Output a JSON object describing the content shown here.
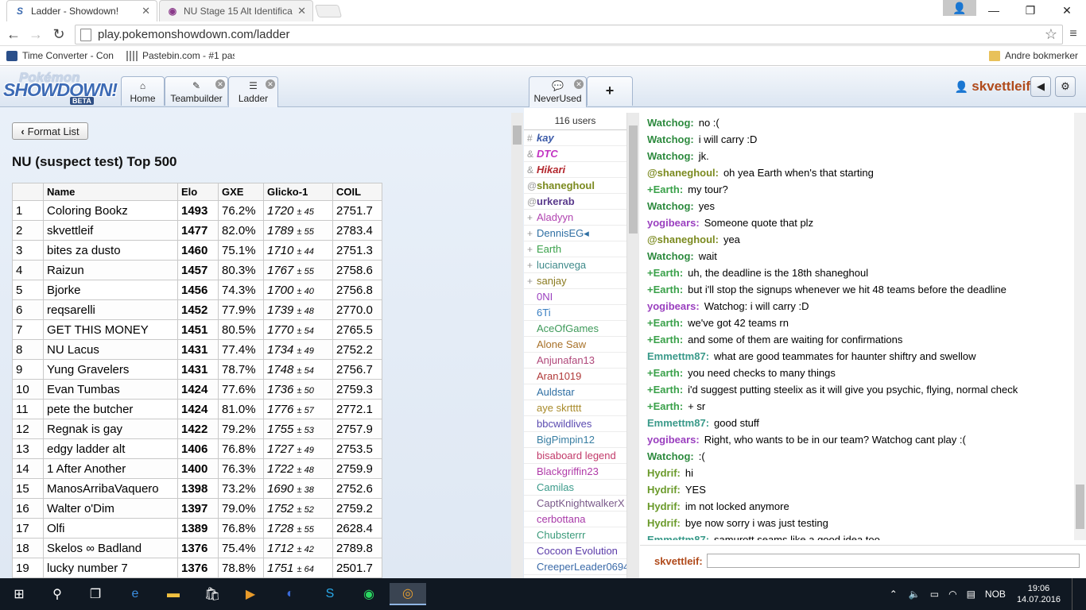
{
  "browser": {
    "tabs": [
      {
        "title": "Ladder - Showdown!",
        "icon": "showdown-favicon"
      },
      {
        "title": "NU Stage 15 Alt Identifica",
        "icon": "forum-favicon"
      }
    ],
    "url": "play.pokemonshowdown.com/ladder",
    "bookmarks": [
      {
        "label": "Time Converter - Con"
      },
      {
        "label": "Pastebin.com - #1 pas"
      }
    ],
    "bookmark_folder": "Andre bokmerker"
  },
  "header": {
    "logo_top": "Pokémon",
    "logo_main": "SHOWDOWN!",
    "logo_badge": "BETA",
    "tabs": [
      {
        "label": "Home",
        "icon": "home-icon"
      },
      {
        "label": "Teambuilder",
        "icon": "pencil-icon"
      },
      {
        "label": "Ladder",
        "icon": "list-icon"
      }
    ],
    "room_tab": "NeverUsed",
    "add_room": "+",
    "username": "skvettleif"
  },
  "ladder": {
    "back_label": "Format List",
    "title": "NU (suspect test) Top 500",
    "columns": [
      "",
      "Name",
      "Elo",
      "GXE",
      "Glicko-1",
      "COIL"
    ],
    "rows": [
      {
        "rank": "1",
        "name": "Coloring Bookz",
        "elo": "1493",
        "gxe": "76.2%",
        "glicko": "1720",
        "dev": "± 45",
        "coil": "2751.7"
      },
      {
        "rank": "2",
        "name": "skvettleif",
        "elo": "1477",
        "gxe": "82.0%",
        "glicko": "1789",
        "dev": "± 55",
        "coil": "2783.4"
      },
      {
        "rank": "3",
        "name": "bites za dusto",
        "elo": "1460",
        "gxe": "75.1%",
        "glicko": "1710",
        "dev": "± 44",
        "coil": "2751.3"
      },
      {
        "rank": "4",
        "name": "Raizun",
        "elo": "1457",
        "gxe": "80.3%",
        "glicko": "1767",
        "dev": "± 55",
        "coil": "2758.6"
      },
      {
        "rank": "5",
        "name": "Bjorke",
        "elo": "1456",
        "gxe": "74.3%",
        "glicko": "1700",
        "dev": "± 40",
        "coil": "2756.8"
      },
      {
        "rank": "6",
        "name": "reqsarelli",
        "elo": "1452",
        "gxe": "77.9%",
        "glicko": "1739",
        "dev": "± 48",
        "coil": "2770.0"
      },
      {
        "rank": "7",
        "name": "GET THIS MONEY",
        "elo": "1451",
        "gxe": "80.5%",
        "glicko": "1770",
        "dev": "± 54",
        "coil": "2765.5"
      },
      {
        "rank": "8",
        "name": "NU Lacus",
        "elo": "1431",
        "gxe": "77.4%",
        "glicko": "1734",
        "dev": "± 49",
        "coil": "2752.2"
      },
      {
        "rank": "9",
        "name": "Yung Gravelers",
        "elo": "1431",
        "gxe": "78.7%",
        "glicko": "1748",
        "dev": "± 54",
        "coil": "2756.7"
      },
      {
        "rank": "10",
        "name": "Evan Tumbas",
        "elo": "1424",
        "gxe": "77.6%",
        "glicko": "1736",
        "dev": "± 50",
        "coil": "2759.3"
      },
      {
        "rank": "11",
        "name": "pete the butcher",
        "elo": "1424",
        "gxe": "81.0%",
        "glicko": "1776",
        "dev": "± 57",
        "coil": "2772.1"
      },
      {
        "rank": "12",
        "name": "Regnak is gay",
        "elo": "1422",
        "gxe": "79.2%",
        "glicko": "1755",
        "dev": "± 53",
        "coil": "2757.9"
      },
      {
        "rank": "13",
        "name": "edgy ladder alt",
        "elo": "1406",
        "gxe": "76.8%",
        "glicko": "1727",
        "dev": "± 49",
        "coil": "2753.5"
      },
      {
        "rank": "14",
        "name": "1 After Another",
        "elo": "1400",
        "gxe": "76.3%",
        "glicko": "1722",
        "dev": "± 48",
        "coil": "2759.9"
      },
      {
        "rank": "15",
        "name": "ManosArribaVaquero",
        "elo": "1398",
        "gxe": "73.2%",
        "glicko": "1690",
        "dev": "± 38",
        "coil": "2752.6"
      },
      {
        "rank": "16",
        "name": "Walter o'Dim",
        "elo": "1397",
        "gxe": "79.0%",
        "glicko": "1752",
        "dev": "± 52",
        "coil": "2759.2"
      },
      {
        "rank": "17",
        "name": "Olfi",
        "elo": "1389",
        "gxe": "76.8%",
        "glicko": "1728",
        "dev": "± 55",
        "coil": "2628.4"
      },
      {
        "rank": "18",
        "name": "Skelos ∞ Badland",
        "elo": "1376",
        "gxe": "75.4%",
        "glicko": "1712",
        "dev": "± 42",
        "coil": "2789.8"
      },
      {
        "rank": "19",
        "name": "lucky number 7",
        "elo": "1376",
        "gxe": "78.8%",
        "glicko": "1751",
        "dev": "± 64",
        "coil": "2501.7"
      }
    ]
  },
  "userlist": {
    "count": "116 users",
    "users": [
      {
        "group": "#",
        "name": "kay",
        "color": "#3b5aa8",
        "bold": true,
        "italic": true
      },
      {
        "group": "&",
        "name": "DTC",
        "color": "#c233c2",
        "bold": true,
        "italic": true
      },
      {
        "group": "&",
        "name": "Hikari",
        "color": "#b3282e",
        "bold": true,
        "italic": true
      },
      {
        "group": "@",
        "name": "shaneghoul",
        "color": "#7b8a1f",
        "bold": true,
        "italic": false
      },
      {
        "group": "@",
        "name": "urkerab",
        "color": "#5a3a8c",
        "bold": true,
        "italic": false
      },
      {
        "group": "+",
        "name": "Aladyyn",
        "color": "#b144b1",
        "bold": false,
        "italic": false
      },
      {
        "group": "+",
        "name": "DennisEG◂",
        "color": "#2f6fa3",
        "bold": false,
        "italic": false
      },
      {
        "group": "+",
        "name": "Earth",
        "color": "#3aa14a",
        "bold": false,
        "italic": false
      },
      {
        "group": "+",
        "name": "lucianvega",
        "color": "#3e8a8a",
        "bold": false,
        "italic": false
      },
      {
        "group": "+",
        "name": "sanjay",
        "color": "#8a7a1f",
        "bold": false,
        "italic": false
      },
      {
        "group": "",
        "name": "0NI",
        "color": "#9a3fbf",
        "bold": false,
        "italic": false
      },
      {
        "group": "",
        "name": "6Ti",
        "color": "#3a7fc2",
        "bold": false,
        "italic": false
      },
      {
        "group": "",
        "name": "AceOfGames",
        "color": "#3f9a5a",
        "bold": false,
        "italic": false
      },
      {
        "group": "",
        "name": "Alone Saw",
        "color": "#a8722a",
        "bold": false,
        "italic": false
      },
      {
        "group": "",
        "name": "Anjunafan13",
        "color": "#b0487a",
        "bold": false,
        "italic": false
      },
      {
        "group": "",
        "name": "Aran1019",
        "color": "#b03a3a",
        "bold": false,
        "italic": false
      },
      {
        "group": "",
        "name": "Auldstar",
        "color": "#2f6fa3",
        "bold": false,
        "italic": false
      },
      {
        "group": "",
        "name": "aye skrtttt",
        "color": "#a88a2a",
        "bold": false,
        "italic": false
      },
      {
        "group": "",
        "name": "bbcwildlives",
        "color": "#5a4ab0",
        "bold": false,
        "italic": false
      },
      {
        "group": "",
        "name": "BigPimpin12",
        "color": "#3a7fa3",
        "bold": false,
        "italic": false
      },
      {
        "group": "",
        "name": "bisaboard legend",
        "color": "#c23a6a",
        "bold": false,
        "italic": false
      },
      {
        "group": "",
        "name": "Blackgriffin23",
        "color": "#b03aa8",
        "bold": false,
        "italic": false
      },
      {
        "group": "",
        "name": "Camilas",
        "color": "#3a9a8a",
        "bold": false,
        "italic": false
      },
      {
        "group": "",
        "name": "CaptKnightwalkerX",
        "color": "#7a5a8a",
        "bold": false,
        "italic": false
      },
      {
        "group": "",
        "name": "cerbottana",
        "color": "#a83aa8",
        "bold": false,
        "italic": false
      },
      {
        "group": "",
        "name": "Chubsterrr",
        "color": "#3a9a7a",
        "bold": false,
        "italic": false
      },
      {
        "group": "",
        "name": "Cocoon Evolution",
        "color": "#5a3aa8",
        "bold": false,
        "italic": false
      },
      {
        "group": "",
        "name": "CreeperLeader0694",
        "color": "#3a6aa8",
        "bold": false,
        "italic": false
      }
    ]
  },
  "chat": {
    "messages": [
      {
        "user": "Watchog:",
        "color": "#2d8a3e",
        "text": "no :("
      },
      {
        "user": "Watchog:",
        "color": "#2d8a3e",
        "text": "i will carry :D"
      },
      {
        "user": "Watchog:",
        "color": "#2d8a3e",
        "text": "jk."
      },
      {
        "user": "@shaneghoul:",
        "color": "#7b8a1f",
        "text": "oh yea Earth when's that starting"
      },
      {
        "user": "+Earth:",
        "color": "#3aa14a",
        "text": "my tour?"
      },
      {
        "user": "Watchog:",
        "color": "#2d8a3e",
        "text": "yes"
      },
      {
        "user": "yogibears:",
        "color": "#9a3fbf",
        "text": "Someone quote that plz"
      },
      {
        "user": "@shaneghoul:",
        "color": "#7b8a1f",
        "text": "yea"
      },
      {
        "user": "Watchog:",
        "color": "#2d8a3e",
        "text": "wait"
      },
      {
        "user": "+Earth:",
        "color": "#3aa14a",
        "text": "uh, the deadline is the 18th shaneghoul"
      },
      {
        "user": "+Earth:",
        "color": "#3aa14a",
        "text": "but i'll stop the signups whenever we hit 48 teams before the deadline"
      },
      {
        "user": "yogibears:",
        "color": "#9a3fbf",
        "text": "Watchog: i will carry :D"
      },
      {
        "user": "+Earth:",
        "color": "#3aa14a",
        "text": "we've got 42 teams rn"
      },
      {
        "user": "+Earth:",
        "color": "#3aa14a",
        "text": "and some of them are waiting for confirmations"
      },
      {
        "user": "Emmettm87:",
        "color": "#3a9a8a",
        "text": "what are good teammates for haunter shiftry and swellow"
      },
      {
        "user": "+Earth:",
        "color": "#3aa14a",
        "text": "you need checks to many things"
      },
      {
        "user": "+Earth:",
        "color": "#3aa14a",
        "text": "i'd suggest putting steelix as it will give you psychic, flying, normal check"
      },
      {
        "user": "+Earth:",
        "color": "#3aa14a",
        "text": "+ sr"
      },
      {
        "user": "Emmettm87:",
        "color": "#3a9a8a",
        "text": "good stuff"
      },
      {
        "user": "yogibears:",
        "color": "#9a3fbf",
        "text": "Right, who wants to be in our team? Watchog cant play :("
      },
      {
        "user": "Watchog:",
        "color": "#2d8a3e",
        "text": ":("
      },
      {
        "user": "Hydrif:",
        "color": "#6a9a2a",
        "text": "hi"
      },
      {
        "user": "Hydrif:",
        "color": "#6a9a2a",
        "text": "YES"
      },
      {
        "user": "Hydrif:",
        "color": "#6a9a2a",
        "text": "im not locked anymore"
      },
      {
        "user": "Hydrif:",
        "color": "#6a9a2a",
        "text": "bye now sorry i was just testing"
      },
      {
        "user": "Emmettm87:",
        "color": "#3a9a8a",
        "text": "samurott seams like a good idea too"
      }
    ],
    "input_label": "skvettleif:"
  },
  "taskbar": {
    "apps": [
      "windows-start-icon",
      "search-icon",
      "task-view-icon",
      "edge-icon",
      "file-explorer-icon",
      "store-icon",
      "media-player-icon",
      "pokemon-app-icon",
      "skype-icon",
      "spotify-icon",
      "chrome-icon"
    ],
    "lang": "NOB",
    "time": "19:06",
    "date": "14.07.2016"
  }
}
